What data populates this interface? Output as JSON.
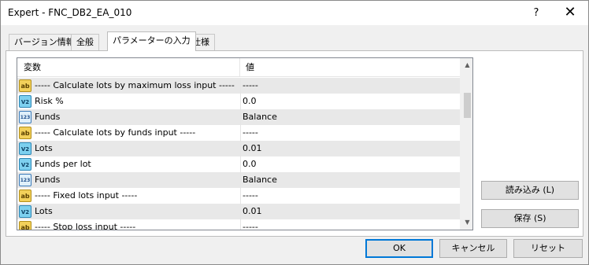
{
  "window": {
    "title": "Expert - FNC_DB2_EA_010",
    "help_glyph": "?",
    "close_glyph": "✕"
  },
  "tabs": [
    {
      "label": "バージョン情報",
      "active": false
    },
    {
      "label": "全般",
      "active": false
    },
    {
      "label": "パラメーターの入力",
      "active": true
    },
    {
      "label": "仕様",
      "active": false
    }
  ],
  "grid": {
    "col_variable": "変数",
    "col_value": "値",
    "rows": [
      {
        "icon": "ab",
        "icon_text": "ab",
        "name": "----- Calculate lots by maximum loss input -----",
        "value": "-----"
      },
      {
        "icon": "double",
        "icon_text": "V2",
        "name": "Risk %",
        "value": "0.0"
      },
      {
        "icon": "enum",
        "icon_text": "123",
        "name": "Funds",
        "value": "Balance"
      },
      {
        "icon": "ab",
        "icon_text": "ab",
        "name": "----- Calculate lots by funds input -----",
        "value": "-----"
      },
      {
        "icon": "double",
        "icon_text": "V2",
        "name": "Lots",
        "value": "0.01"
      },
      {
        "icon": "double",
        "icon_text": "V2",
        "name": "Funds per lot",
        "value": "0.0"
      },
      {
        "icon": "enum",
        "icon_text": "123",
        "name": "Funds",
        "value": "Balance"
      },
      {
        "icon": "ab",
        "icon_text": "ab",
        "name": "----- Fixed lots input -----",
        "value": "-----"
      },
      {
        "icon": "double",
        "icon_text": "V2",
        "name": "Lots",
        "value": "0.01"
      },
      {
        "icon": "ab",
        "icon_text": "ab",
        "name": "----- Stop loss input -----",
        "value": "-----"
      }
    ],
    "scroll_up": "▲",
    "scroll_down": "▼"
  },
  "side_buttons": {
    "load": "読み込み (L)",
    "save": "保存 (S)"
  },
  "footer_buttons": {
    "ok": "OK",
    "cancel": "キャンセル",
    "reset": "リセット"
  }
}
